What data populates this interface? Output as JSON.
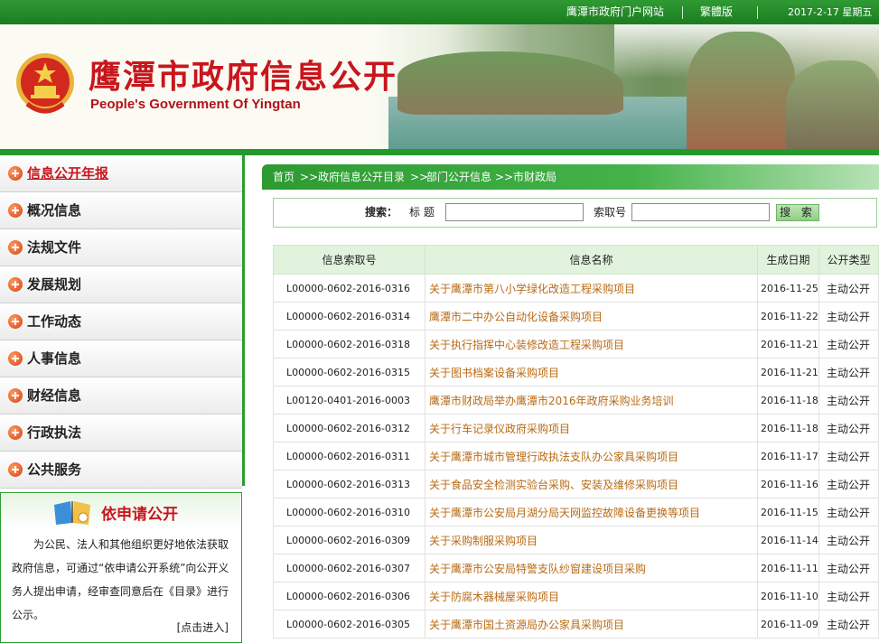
{
  "topbar": {
    "portal_link": "鹰潭市政府门户网站",
    "traditional_link": "繁體版",
    "date": "2017-2-17 星期五"
  },
  "header": {
    "title_cn": "鹰潭市政府信息公开",
    "title_en": "People's Government Of Yingtan"
  },
  "sidebar": {
    "items": [
      {
        "label": "信息公开年报"
      },
      {
        "label": "概况信息"
      },
      {
        "label": "法规文件"
      },
      {
        "label": "发展规划"
      },
      {
        "label": "工作动态"
      },
      {
        "label": "人事信息"
      },
      {
        "label": "财经信息"
      },
      {
        "label": "行政执法"
      },
      {
        "label": "公共服务"
      }
    ],
    "apply": {
      "title": "依申请公开",
      "text": "为公民、法人和其他组织更好地依法获取政府信息，可通过“依申请公开系统”向公开义务人提出申请，经审查同意后在《目录》进行公示。",
      "enter_link": "[点击进入]"
    }
  },
  "breadcrumb": {
    "items": [
      "首页",
      "政府信息公开目录",
      "部门公开信息",
      "市财政局"
    ],
    "separator": ">>"
  },
  "search": {
    "label": "搜索：",
    "title_label": "标 题",
    "title_value": "",
    "index_label": "索取号",
    "index_value": "",
    "button": "搜 索"
  },
  "table": {
    "columns": [
      "信息索取号",
      "信息名称",
      "生成日期",
      "公开类型"
    ],
    "rows": [
      {
        "index": "L00000-0602-2016-0316",
        "name": "关于鹰潭市第八小学绿化改造工程采购项目",
        "date": "2016-11-25",
        "type": "主动公开"
      },
      {
        "index": "L00000-0602-2016-0314",
        "name": "鹰潭市二中办公自动化设备采购项目",
        "date": "2016-11-22",
        "type": "主动公开"
      },
      {
        "index": "L00000-0602-2016-0318",
        "name": "关于执行指挥中心装修改造工程采购项目",
        "date": "2016-11-21",
        "type": "主动公开"
      },
      {
        "index": "L00000-0602-2016-0315",
        "name": "关于图书档案设备采购项目",
        "date": "2016-11-21",
        "type": "主动公开"
      },
      {
        "index": "L00120-0401-2016-0003",
        "name": "鹰潭市财政局举办鹰潭市2016年政府采购业务培训",
        "date": "2016-11-18",
        "type": "主动公开"
      },
      {
        "index": "L00000-0602-2016-0312",
        "name": "关于行车记录仪政府采购项目",
        "date": "2016-11-18",
        "type": "主动公开"
      },
      {
        "index": "L00000-0602-2016-0311",
        "name": "关于鹰潭市城市管理行政执法支队办公家具采购项目",
        "date": "2016-11-17",
        "type": "主动公开"
      },
      {
        "index": "L00000-0602-2016-0313",
        "name": "关于食品安全检测实验台采购、安装及维修采购项目",
        "date": "2016-11-16",
        "type": "主动公开"
      },
      {
        "index": "L00000-0602-2016-0310",
        "name": "关于鹰潭市公安局月湖分局天网监控故障设备更换等项目",
        "date": "2016-11-15",
        "type": "主动公开"
      },
      {
        "index": "L00000-0602-2016-0309",
        "name": "关于采购制服采购项目",
        "date": "2016-11-14",
        "type": "主动公开"
      },
      {
        "index": "L00000-0602-2016-0307",
        "name": "关于鹰潭市公安局特警支队纱窗建设项目采购",
        "date": "2016-11-11",
        "type": "主动公开"
      },
      {
        "index": "L00000-0602-2016-0306",
        "name": "关于防腐木器械屋采购项目",
        "date": "2016-11-10",
        "type": "主动公开"
      },
      {
        "index": "L00000-0602-2016-0305",
        "name": "关于鹰潭市国土资源局办公家具采购项目",
        "date": "2016-11-09",
        "type": "主动公开"
      }
    ]
  },
  "colors": {
    "brand_green": "#239a2a",
    "title_red": "#c8161d",
    "link_brown": "#b86a14"
  }
}
